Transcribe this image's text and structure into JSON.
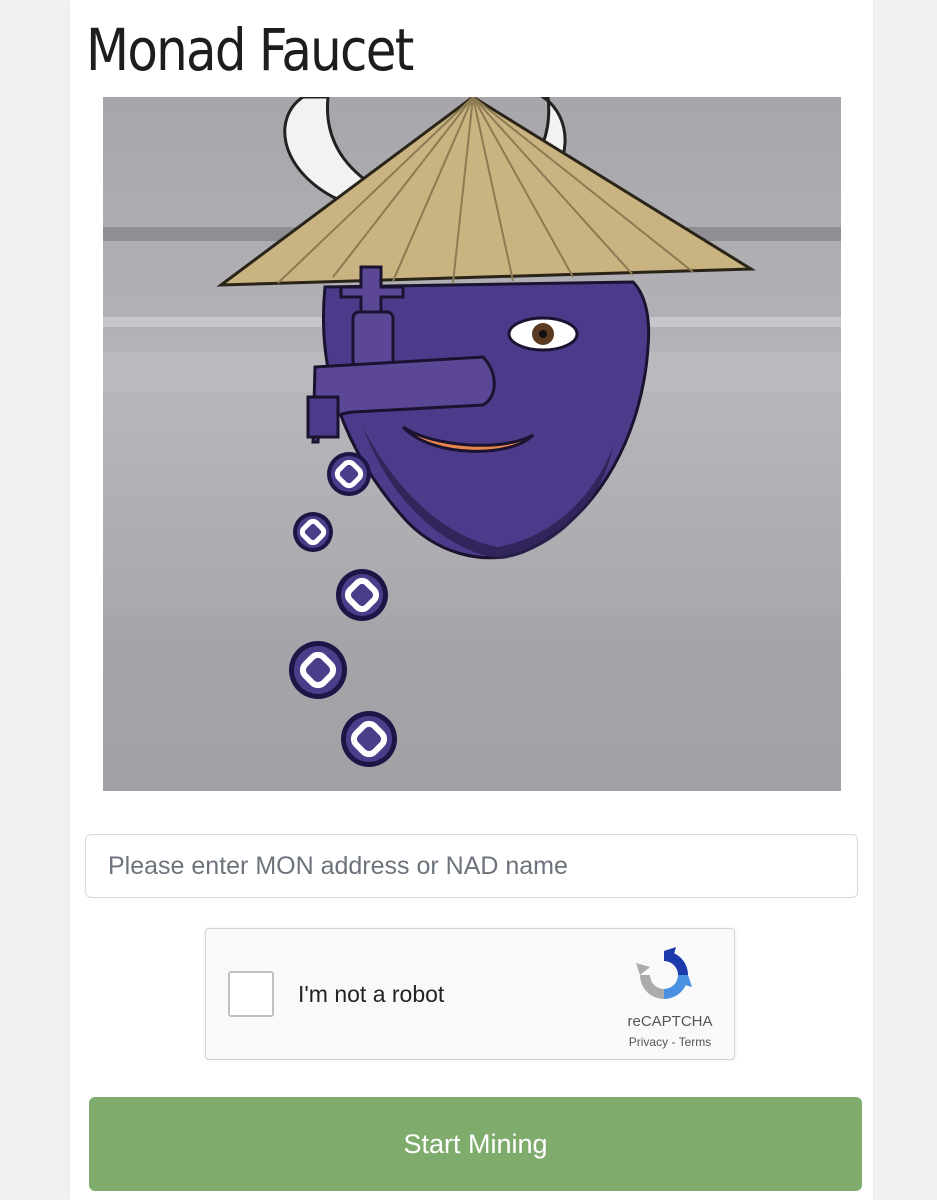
{
  "page": {
    "title": "Monad Faucet"
  },
  "form": {
    "address_value": "",
    "address_placeholder": "Please enter MON address or NAD name",
    "submit_label": "Start Mining"
  },
  "captcha": {
    "label": "I'm not a robot",
    "brand": "reCAPTCHA",
    "privacy": "Privacy",
    "separator": " - ",
    "terms": "Terms",
    "checked": false
  },
  "colors": {
    "accent_button": "#7fab6d",
    "mascot_face": "#4e3a8a",
    "coin": "#1d1545"
  },
  "icons": {
    "captcha_logo": "recaptcha-logo-icon",
    "coins": "monad-coin-icon"
  }
}
